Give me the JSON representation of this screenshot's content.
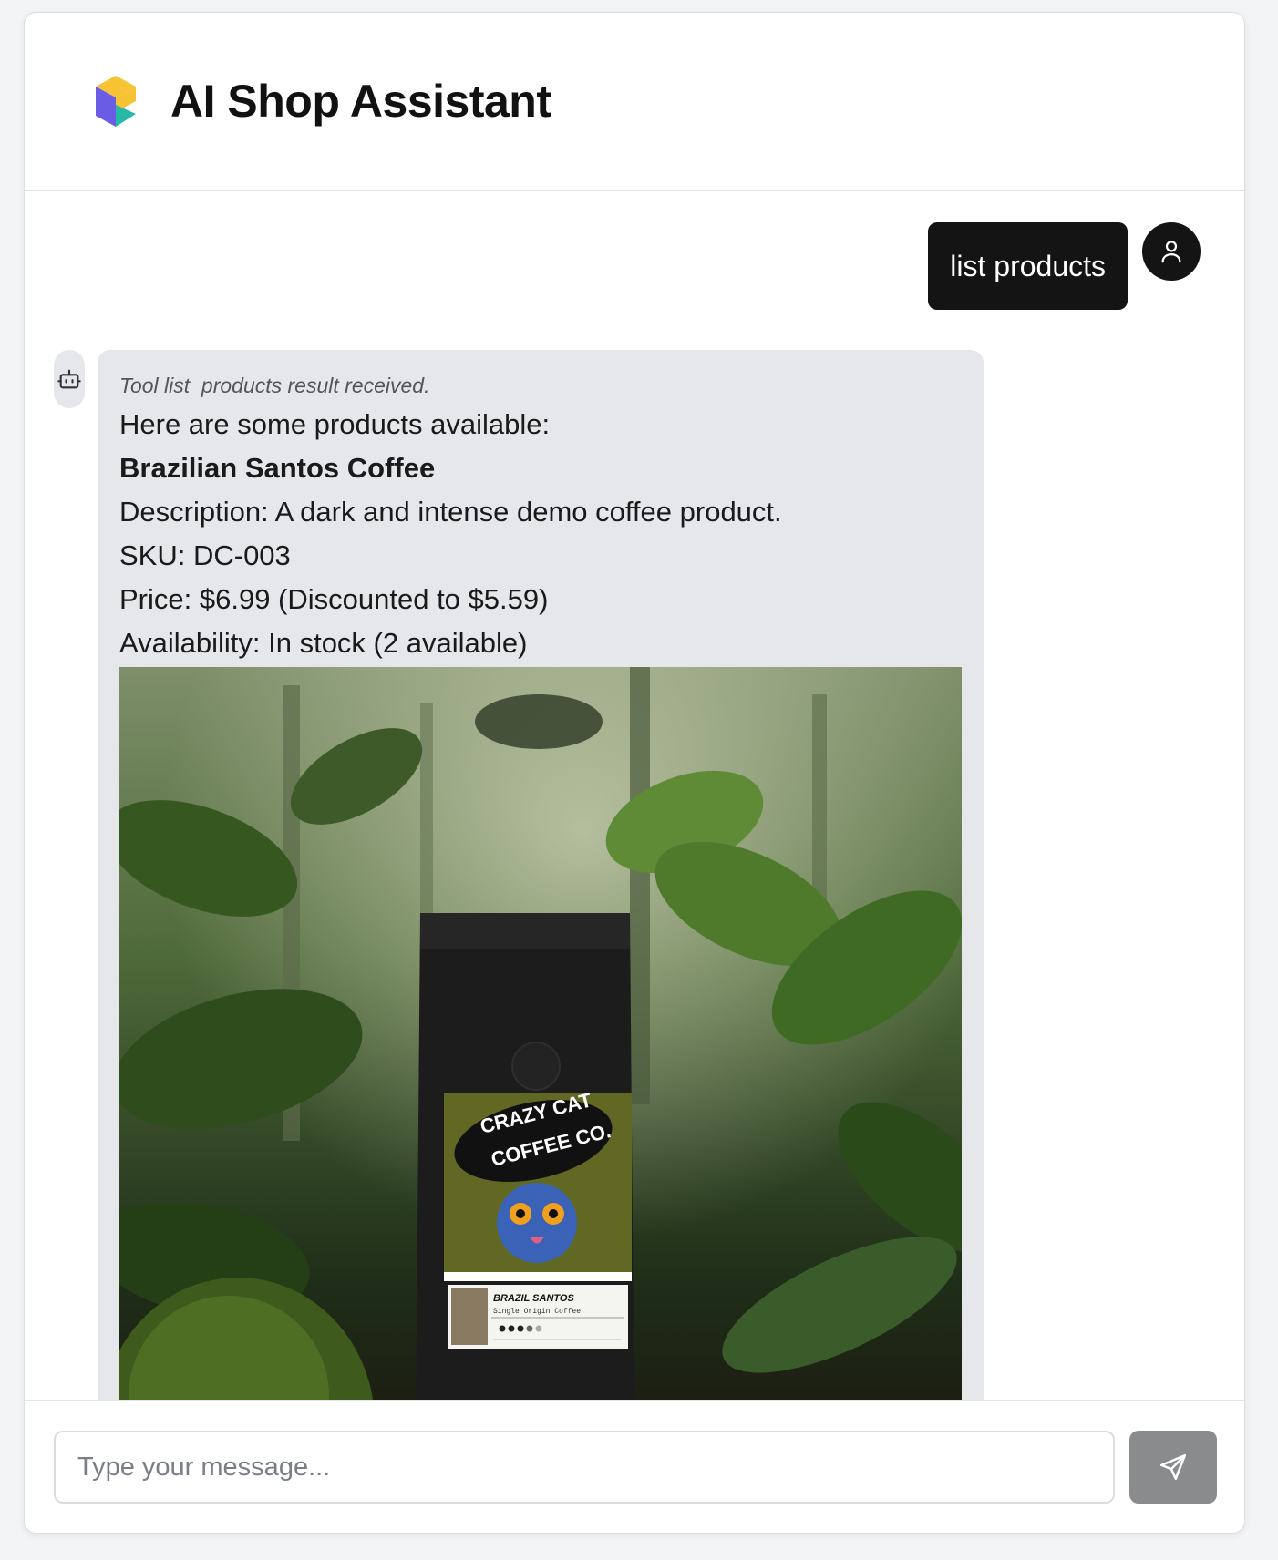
{
  "header": {
    "title": "AI Shop Assistant",
    "logo_icon": "cube-logo-icon"
  },
  "conversation": {
    "user_message": "list products",
    "user_avatar_icon": "user-icon",
    "bot_avatar_icon": "robot-icon",
    "bot_message": {
      "tool_note": "Tool list_products result received.",
      "intro": "Here are some products available:",
      "product": {
        "name": "Brazilian Santos Coffee",
        "description": "Description: A dark and intense demo coffee product.",
        "sku": "SKU: DC-003",
        "price": "Price: $6.99 (Discounted to $5.59)",
        "availability": "Availability: In stock (2 available)",
        "image_alt": "Crazy Cat Coffee Co. Brazil Santos coffee bag in jungle",
        "bag_brand_text": "CRAZY CAT COFFEE CO.",
        "bag_label_text": "BRAZIL SANTOS",
        "bag_sub_text": "Single Origin Coffee"
      }
    }
  },
  "composer": {
    "placeholder": "Type your message...",
    "send_icon": "send-icon"
  },
  "colors": {
    "user_bubble": "#141414",
    "bot_bubble": "#e5e7eb",
    "send_button": "#8a8b8d"
  }
}
